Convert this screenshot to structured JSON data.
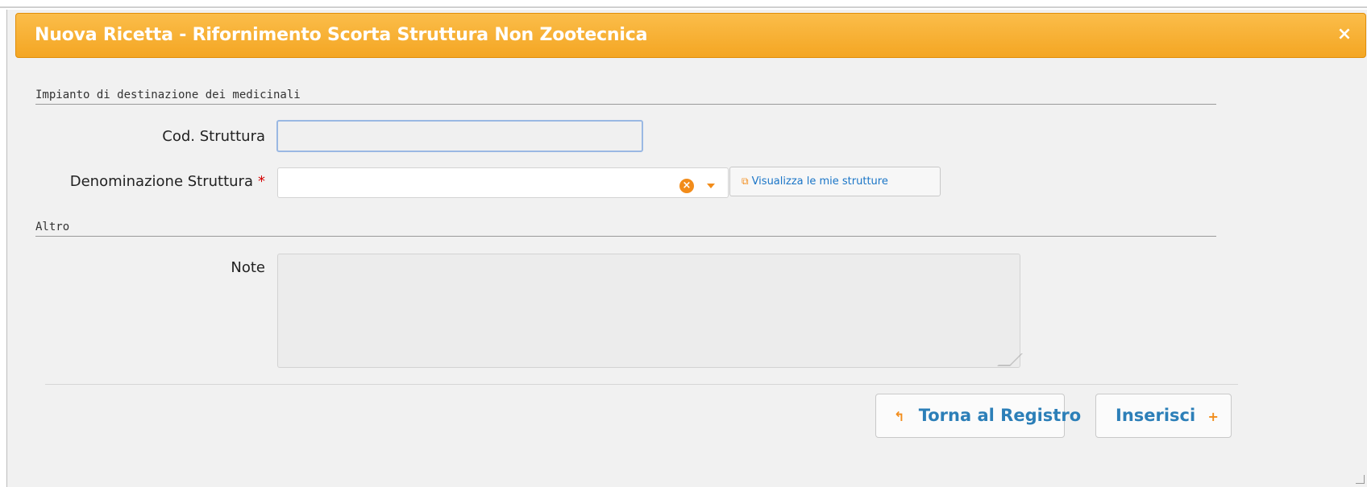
{
  "dialog": {
    "title": "Nuova Ricetta - Rifornimento Scorta Struttura Non Zootecnica",
    "close_icon": "×"
  },
  "section_destination": {
    "title": "Impianto di destinazione dei medicinali",
    "cod_label": "Cod. Struttura",
    "cod_value": "",
    "denominazione_label": "Denominazione Struttura",
    "required_mark": "*",
    "denominazione_value": "",
    "show_structures_button": "Visualizza le mie strutture"
  },
  "section_other": {
    "title": "Altro",
    "note_label": "Note",
    "note_value": ""
  },
  "footer": {
    "back_button": "Torna al Registro",
    "insert_button": "Inserisci"
  },
  "colors": {
    "title_bar": "#f4a623",
    "accent": "#f28c1a",
    "link_blue": "#2c7fb8"
  },
  "icons": {
    "clear": "close-circle-icon",
    "dropdown": "caret-down-icon",
    "window": "window-icon",
    "back": "reply-icon",
    "add": "plus-icon"
  }
}
